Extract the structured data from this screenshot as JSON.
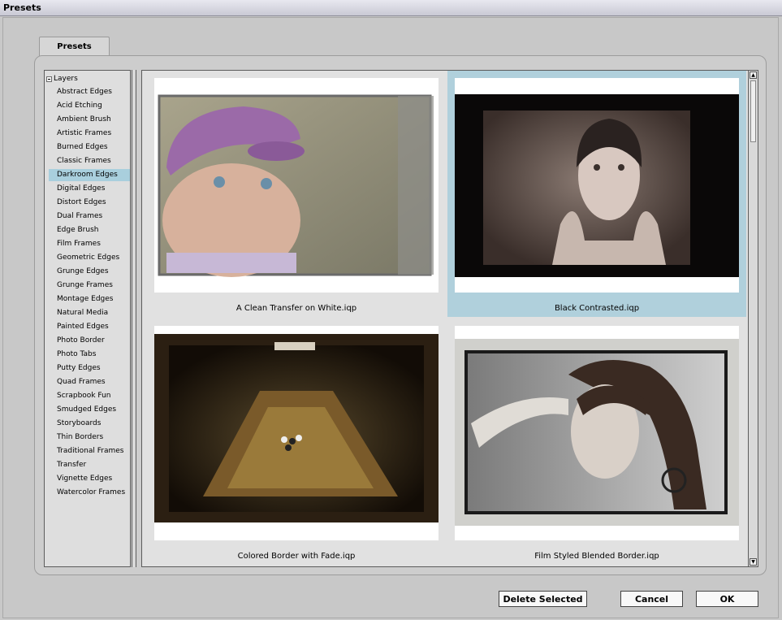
{
  "window": {
    "title": "Presets"
  },
  "tabs": [
    {
      "label": "Presets"
    }
  ],
  "tree": {
    "root_label": "Layers",
    "items": [
      "Abstract Edges",
      "Acid Etching",
      "Ambient Brush",
      "Artistic Frames",
      "Burned Edges",
      "Classic Frames",
      "Darkroom Edges",
      "Digital Edges",
      "Distort Edges",
      "Dual Frames",
      "Edge Brush",
      "Film Frames",
      "Geometric Edges",
      "Grunge Edges",
      "Grunge Frames",
      "Montage Edges",
      "Natural Media",
      "Painted Edges",
      "Photo Border",
      "Photo Tabs",
      "Putty Edges",
      "Quad Frames",
      "Scrapbook Fun",
      "Smudged Edges",
      "Storyboards",
      "Thin Borders",
      "Traditional Frames",
      "Transfer",
      "Vignette Edges",
      "Watercolor Frames"
    ],
    "selected": "Darkroom Edges"
  },
  "presets": [
    {
      "name": "A Clean Transfer on White.iqp",
      "selected": false
    },
    {
      "name": "Black Contrasted.iqp",
      "selected": true
    },
    {
      "name": "Colored Border with Fade.iqp",
      "selected": false
    },
    {
      "name": "Film Styled Blended Border.iqp",
      "selected": false
    }
  ],
  "buttons": {
    "delete_label": "Delete Selected",
    "cancel_label": "Cancel",
    "ok_label": "OK"
  },
  "colors": {
    "selection": "#a9cfdd",
    "panel": "#cdcdcd"
  }
}
